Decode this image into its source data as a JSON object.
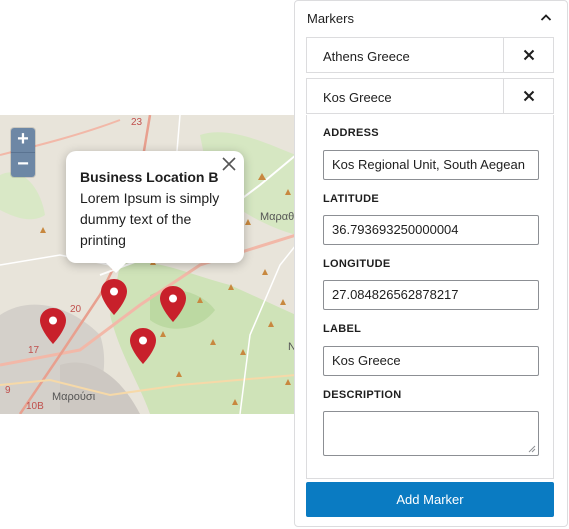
{
  "map": {
    "zoom_in": "+",
    "zoom_out": "−",
    "labels": [
      "23",
      "20",
      "17",
      "9",
      "10B",
      "Μαρούσι",
      "Μαραθ",
      "Ν"
    ],
    "popup": {
      "title": "Business Location B",
      "text": "Lorem Ipsum is simply dummy text of the printing"
    },
    "marker_color": "#c8202b"
  },
  "sidebar": {
    "title": "Markers",
    "items": [
      {
        "label": "Athens Greece"
      },
      {
        "label": "Kos Greece"
      }
    ],
    "form": {
      "address_label": "ADDRESS",
      "address_value": "Kos Regional Unit, South Aegean",
      "latitude_label": "LATITUDE",
      "latitude_value": "36.793693250000004",
      "longitude_label": "LONGITUDE",
      "longitude_value": "27.084826562878217",
      "label_label": "LABEL",
      "label_value": "Kos Greece",
      "description_label": "DESCRIPTION",
      "description_value": ""
    },
    "add_button": "Add Marker",
    "accent": "#0a7bc2"
  }
}
